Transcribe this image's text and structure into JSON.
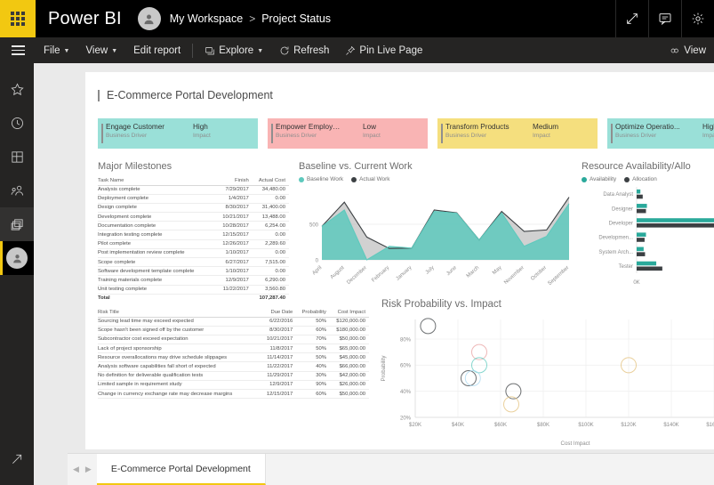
{
  "topbar": {
    "brand": "Power BI",
    "workspace": "My Workspace",
    "separator": ">",
    "report": "Project Status",
    "actions": [
      {
        "name": "fullscreen-icon",
        "label": "Full screen"
      },
      {
        "name": "comment-icon",
        "label": "Comments"
      },
      {
        "name": "settings-gear-icon",
        "label": "Settings"
      }
    ]
  },
  "toolbar": {
    "file": "File",
    "view": "View",
    "edit_report": "Edit report",
    "explore": "Explore",
    "refresh": "Refresh",
    "pin_live_page": "Pin Live Page",
    "view_right": "View"
  },
  "rail": {
    "items": [
      {
        "name": "favorites-icon",
        "label": "Favorites"
      },
      {
        "name": "recent-icon",
        "label": "Recent"
      },
      {
        "name": "apps-icon",
        "label": "Apps"
      },
      {
        "name": "shared-with-me-icon",
        "label": "Shared with me"
      },
      {
        "name": "workspaces-icon",
        "label": "Workspaces"
      },
      {
        "name": "my-workspace-avatar",
        "label": "My Workspace"
      }
    ],
    "bottom": {
      "name": "expand-nav-icon",
      "label": "Expand"
    }
  },
  "report": {
    "title": "E-Commerce Portal Development",
    "page_tab": "E-Commerce Portal Development"
  },
  "kpi_cards": {
    "label_driver": "Business Driver",
    "label_impact": "Impact",
    "items": [
      {
        "driver": "Engage Customer",
        "impact": "High",
        "color": "#9ae0d8"
      },
      {
        "driver": "Empower Employees",
        "impact": "Low",
        "color": "#f9b4b4"
      },
      {
        "driver": "Transform Products",
        "impact": "Medium",
        "color": "#f5df7e"
      },
      {
        "driver": "Optimize Operatio...",
        "impact": "High",
        "color": "#9ae0d8"
      }
    ]
  },
  "milestones": {
    "title": "Major Milestones",
    "columns": [
      "Task Name",
      "Finish",
      "Actual Cost"
    ],
    "rows": [
      [
        "Analysis complete",
        "7/29/2017",
        "34,480.00"
      ],
      [
        "Deployment complete",
        "1/4/2017",
        "0.00"
      ],
      [
        "Design complete",
        "8/30/2017",
        "31,400.00"
      ],
      [
        "Development complete",
        "10/21/2017",
        "13,488.00"
      ],
      [
        "Documentation complete",
        "10/28/2017",
        "6,254.00"
      ],
      [
        "Integration testing complete",
        "12/15/2017",
        "0.00"
      ],
      [
        "Pilot complete",
        "12/26/2017",
        "2,289.60"
      ],
      [
        "Post implementation review complete",
        "1/10/2017",
        "0.00"
      ],
      [
        "Scope complete",
        "6/27/2017",
        "7,515.00"
      ],
      [
        "Software development template complete",
        "1/10/2017",
        "0.00"
      ],
      [
        "Training materials complete",
        "12/9/2017",
        "6,290.00"
      ],
      [
        "Unit testing complete",
        "11/22/2017",
        "3,560.80"
      ]
    ],
    "total_label": "Total",
    "total_value": "107,287.40"
  },
  "risks": {
    "columns": [
      "Risk Title",
      "Due Date",
      "Probability",
      "Cost Impact"
    ],
    "rows": [
      [
        "Sourcing lead time may exceed expected",
        "6/22/2016",
        "50%",
        "$120,000.00"
      ],
      [
        "Scope hasn't been signed off by the customer",
        "8/30/2017",
        "60%",
        "$180,000.00"
      ],
      [
        "Subcontractor cost exceed expectation",
        "10/21/2017",
        "70%",
        "$50,000.00"
      ],
      [
        "Lack of project sponsorship",
        "11/8/2017",
        "50%",
        "$65,000.00"
      ],
      [
        "Resource overallocations may drive schedule slippages",
        "11/14/2017",
        "50%",
        "$45,000.00"
      ],
      [
        "Analysis software capabilities fall short of expected",
        "11/22/2017",
        "40%",
        "$66,000.00"
      ],
      [
        "No definition for deliverable qualification tests",
        "11/29/2017",
        "30%",
        "$42,000.00"
      ],
      [
        "Limited sample in requirement study",
        "12/9/2017",
        "90%",
        "$26,000.00"
      ],
      [
        "Change in currency exchange rate may decrease margins",
        "12/15/2017",
        "60%",
        "$50,000.00"
      ]
    ]
  },
  "chart_data": [
    {
      "id": "baseline-vs-current-work",
      "type": "area",
      "title": "Baseline vs. Current Work",
      "xlabel": "",
      "ylabel": "",
      "ylim": [
        0,
        1000
      ],
      "yticks": [
        "0",
        "500"
      ],
      "categories": [
        "April",
        "August",
        "December",
        "February",
        "January",
        "July",
        "June",
        "March",
        "May",
        "November",
        "October",
        "September"
      ],
      "legend": [
        "Baseline Work",
        "Actual Work"
      ],
      "legend_position": "top-left",
      "grid": false,
      "series": [
        {
          "name": "Baseline Work",
          "color": "#5ec9bd",
          "values": [
            470,
            700,
            0,
            190,
            165,
            680,
            655,
            280,
            660,
            190,
            330,
            790
          ]
        },
        {
          "name": "Actual Work",
          "color": "#3c4043",
          "values": [
            470,
            810,
            320,
            160,
            165,
            700,
            660,
            280,
            680,
            400,
            420,
            880
          ]
        }
      ]
    },
    {
      "id": "resource-availability-allocation",
      "type": "bar",
      "title": "Resource Availability/Allo",
      "xlabel": "",
      "ylabel": "",
      "xticks": [
        "0K"
      ],
      "categories": [
        "Data Analyst",
        "Designer",
        "Developer",
        "Developmen...",
        "System Arch...",
        "Tester"
      ],
      "legend": [
        "Availability",
        "Allocation"
      ],
      "legend_position": "top-left",
      "grid": false,
      "series": [
        {
          "name": "Availability",
          "color": "#2aa99b",
          "values": [
            8,
            22,
            230,
            20,
            15,
            42
          ]
        },
        {
          "name": "Allocation",
          "color": "#3c4043",
          "values": [
            13,
            20,
            225,
            17,
            18,
            55
          ]
        }
      ]
    },
    {
      "id": "risk-probability-vs-impact",
      "type": "scatter",
      "title": "Risk Probability vs. Impact",
      "xlabel": "Cost Impact",
      "ylabel": "Probability",
      "xticks": [
        "$20K",
        "$40K",
        "$60K",
        "$80K",
        "$100K",
        "$120K",
        "$140K",
        "$160K"
      ],
      "yticks": [
        "20%",
        "40%",
        "60%",
        "80%"
      ],
      "xlim": [
        20000,
        170000
      ],
      "ylim": [
        20,
        95
      ],
      "grid": true,
      "points": [
        {
          "label": "Limited sample in requirement study",
          "x": 26000,
          "y": 90,
          "color": "#3c4043"
        },
        {
          "label": "Subcontractor cost exceed expectation",
          "x": 50000,
          "y": 70,
          "color": "#e8a0a0"
        },
        {
          "label": "Change in currency exchange rate may decrease margins",
          "x": 50000,
          "y": 60,
          "color": "#5ec9bd"
        },
        {
          "label": "Scope hasn't been signed off by the customer",
          "x": 120000,
          "y": 60,
          "color": "#e3c07b"
        },
        {
          "label": "Resource overallocations may drive schedule slippages",
          "x": 45000,
          "y": 50,
          "color": "#3c4043"
        },
        {
          "label": "Lack of project sponsorship",
          "x": 47000,
          "y": 50,
          "color": "#a9d8f0"
        },
        {
          "label": "Analysis software capabilities fall short of expected",
          "x": 66000,
          "y": 40,
          "color": "#3c4043"
        },
        {
          "label": "No definition for deliverable qualification tests",
          "x": 65000,
          "y": 30,
          "color": "#e3c07b"
        }
      ]
    }
  ]
}
